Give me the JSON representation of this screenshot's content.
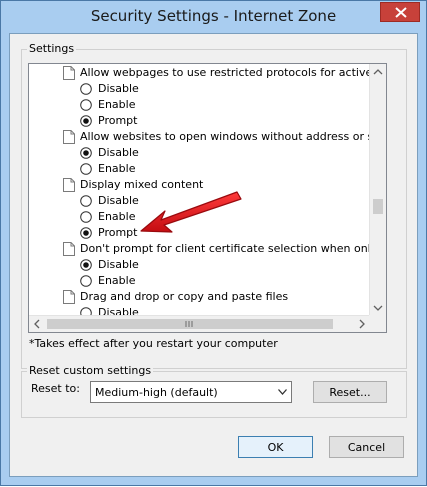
{
  "window": {
    "title": "Security Settings - Internet Zone"
  },
  "settings_group": {
    "label": "Settings"
  },
  "list": {
    "rows": [
      {
        "kind": "heading",
        "text": "Allow webpages to use restricted protocols for active conten"
      },
      {
        "kind": "option",
        "text": "Disable",
        "checked": false
      },
      {
        "kind": "option",
        "text": "Enable",
        "checked": false
      },
      {
        "kind": "option",
        "text": "Prompt",
        "checked": true
      },
      {
        "kind": "heading",
        "text": "Allow websites to open windows without address or status ba"
      },
      {
        "kind": "option",
        "text": "Disable",
        "checked": true
      },
      {
        "kind": "option",
        "text": "Enable",
        "checked": false
      },
      {
        "kind": "heading",
        "text": "Display mixed content"
      },
      {
        "kind": "option",
        "text": "Disable",
        "checked": false
      },
      {
        "kind": "option",
        "text": "Enable",
        "checked": false
      },
      {
        "kind": "option",
        "text": "Prompt",
        "checked": true
      },
      {
        "kind": "heading",
        "text": "Don't prompt for client certificate selection when only one ce"
      },
      {
        "kind": "option",
        "text": "Disable",
        "checked": true
      },
      {
        "kind": "option",
        "text": "Enable",
        "checked": false
      },
      {
        "kind": "heading",
        "text": "Drag and drop or copy and paste files"
      },
      {
        "kind": "option",
        "text": "Disable",
        "checked": false
      }
    ]
  },
  "note": "*Takes effect after you restart your computer",
  "reset_group": {
    "label": "Reset custom settings",
    "reset_to_label": "Reset to:",
    "selected": "Medium-high (default)",
    "reset_button": "Reset..."
  },
  "footer": {
    "ok": "OK",
    "cancel": "Cancel"
  },
  "colors": {
    "titlebar": "#a9cdf0",
    "close": "#c7413a",
    "annotation_arrow": "#e0161b"
  }
}
